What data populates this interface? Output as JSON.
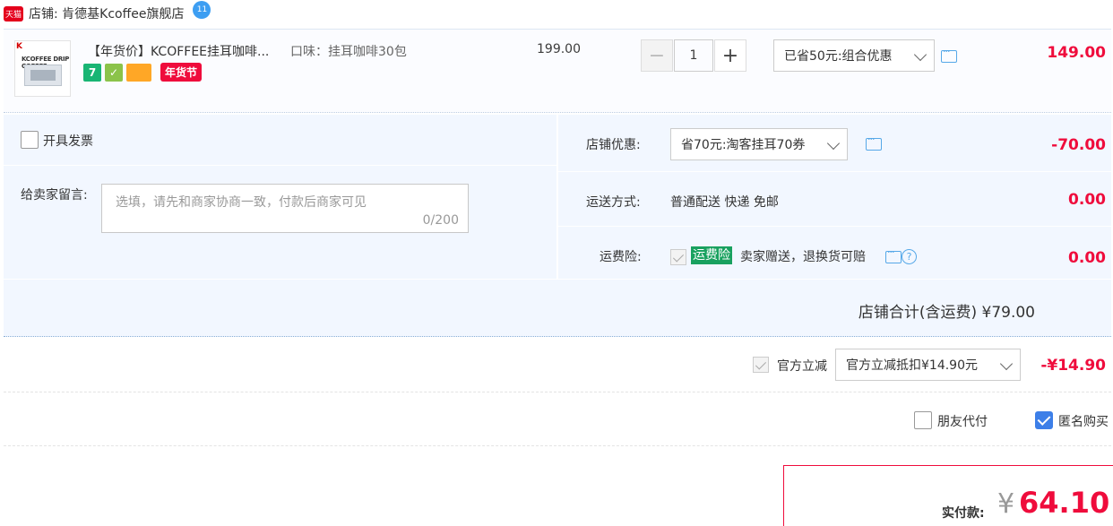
{
  "shop": {
    "tmall_badge": "天猫",
    "name": "店铺: 肯德基Kcoffee旗舰店",
    "ww_badge": "11"
  },
  "item": {
    "thumb_k": "K",
    "thumb_brand": "KCOFFEE DRIP COFFEE",
    "title": "【年货价】KCOFFEE挂耳咖啡...",
    "flavor": "口味：挂耳咖啡30包",
    "badge_seven": "7",
    "festival_badge": "年货节",
    "price": "199.00",
    "qty_minus": "−",
    "qty_value": "1",
    "qty_plus": "+",
    "discount_select": "已省50元:组合优惠",
    "subtotal": "149.00"
  },
  "options": {
    "invoice_label": "开具发票",
    "message_label": "给卖家留言:",
    "message_placeholder": "选填，请先和商家协商一致，付款后商家可见",
    "message_count": "0/200"
  },
  "promo": {
    "shop_coupon_label": "店铺优惠:",
    "shop_coupon_select": "省70元:淘客挂耳70券",
    "shop_coupon_value": "-70.00",
    "shipping_label": "运送方式:",
    "shipping_text": "普通配送 快递 免邮",
    "shipping_value": "0.00",
    "insurance_label": "运费险:",
    "insurance_tag": "运费险",
    "insurance_text": "卖家赠送，退换货可赔",
    "insurance_qmark": "?",
    "insurance_value": "0.00"
  },
  "totals": {
    "shop_total": "店铺合计(含运费)  ¥79.00",
    "official_label": "官方立减",
    "official_select": "官方立减抵扣¥14.90元",
    "official_value": "-¥14.90",
    "friend_pay_label": "朋友代付",
    "anonymous_label": "匿名购买",
    "pay_label": "实付款:",
    "pay_currency": "¥",
    "pay_value": "64.10"
  },
  "colors": {
    "accent_red": "#ef0c3c",
    "panel_blue": "#f2f7ff",
    "checkbox_blue": "#3d7fe8",
    "insurance_green": "#19a15f"
  }
}
